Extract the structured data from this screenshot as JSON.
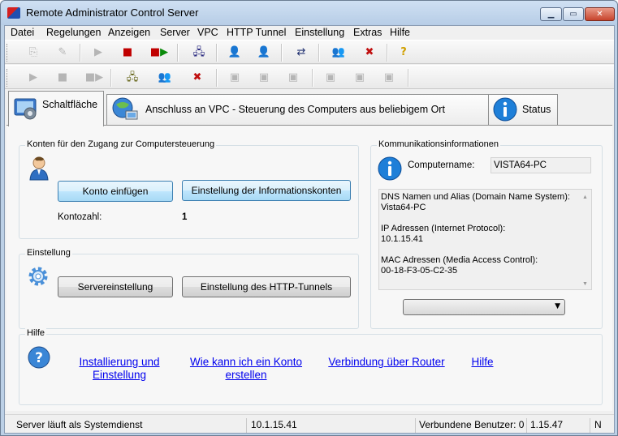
{
  "window": {
    "title": "Remote Administrator Control Server"
  },
  "menu": [
    "Datei",
    "Regelungen",
    "Anzeigen",
    "Server",
    "VPC",
    "HTTP Tunnel",
    "Einstellung",
    "Extras",
    "Hilfe"
  ],
  "tabs": {
    "schaltflaeche": "Schaltfläche",
    "vpc": "Anschluss an VPC - Steuerung des Computers aus beliebigem Ort",
    "status": "Status"
  },
  "accounts_group": {
    "title": "Konten für den Zugang zur Computersteuerung",
    "insert_button": "Konto einfügen",
    "info_button": "Einstellung der Informationskonten",
    "count_label": "Kontozahl:",
    "count_value": "1"
  },
  "settings_group": {
    "title": "Einstellung",
    "server_button": "Servereinstellung",
    "http_button": "Einstellung des HTTP-Tunnels"
  },
  "comm_group": {
    "title": "Kommunikationsinformationen",
    "computer_label": "Computername:",
    "computer_value": "VISTA64-PC",
    "info_lines": {
      "dns_title": "DNS Namen und Alias (Domain Name System):",
      "dns_value": "Vista64-PC",
      "ip_title": "IP Adressen (Internet Protocol):",
      "ip_value": "10.1.15.41",
      "mac_title": "MAC Adressen (Media Access Control):",
      "mac_value": "00-18-F3-05-C2-35"
    },
    "combo_value": ""
  },
  "help_group": {
    "title": "Hilfe",
    "link1_line1": "Installierung und",
    "link1_line2": "Einstellung",
    "link2_line1": "Wie kann ich ein Konto",
    "link2_line2": "erstellen",
    "link3": "Verbindung über Router",
    "link4": "Hilfe"
  },
  "status": {
    "service": "Server läuft als Systemdienst",
    "ip": "10.1.15.41",
    "users": "Verbundene Benutzer: 0",
    "version": "1.15.47",
    "extra": "N"
  },
  "colors": {
    "link": "#0000ee",
    "info_icon": "#1e7fd8",
    "close_button": "#c7442c"
  }
}
